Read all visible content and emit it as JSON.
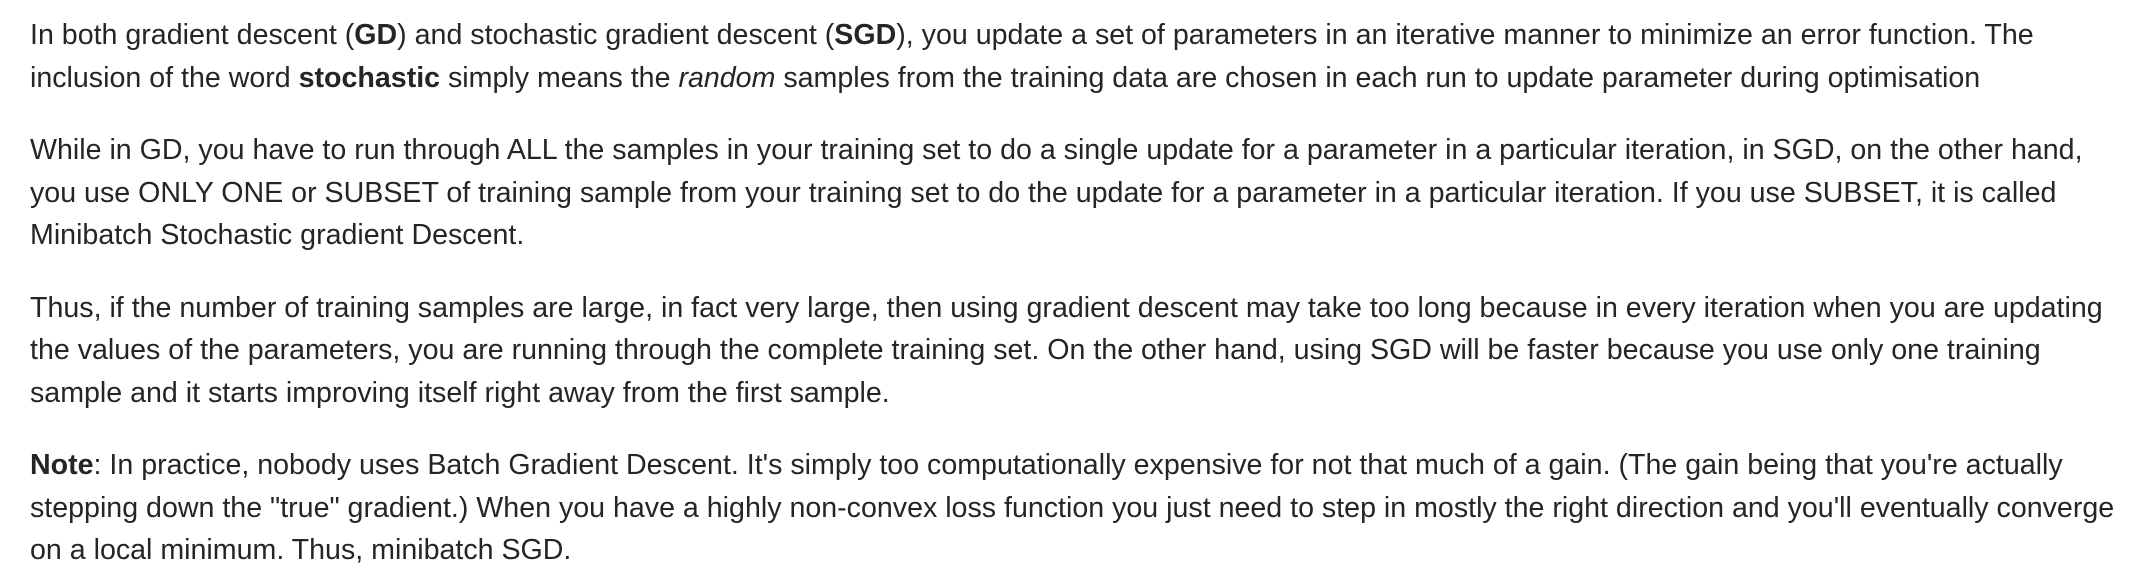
{
  "answer": {
    "p1": {
      "s1": "In both gradient descent (",
      "gd": "GD",
      "s2": ") and stochastic gradient descent (",
      "sgd": "SGD",
      "s3": "), you update a set of parameters in an iterative manner to minimize an error function. The inclusion of the word ",
      "stochastic": "stochastic",
      "s4": " simply means the ",
      "random": "random",
      "s5": " samples from the training data are chosen in each run to update parameter during optimisation"
    },
    "p2": "While in GD, you have to run through ALL the samples in your training set to do a single update for a parameter in a particular iteration, in SGD, on the other hand, you use ONLY ONE or SUBSET of training sample from your training set to do the update for a parameter in a particular iteration. If you use SUBSET, it is called Minibatch Stochastic gradient Descent.",
    "p3": "Thus, if the number of training samples are large, in fact very large, then using gradient descent may take too long because in every iteration when you are updating the values of the parameters, you are running through the complete training set. On the other hand, using SGD will be faster because you use only one training sample and it starts improving itself right away from the first sample.",
    "p4": {
      "note_label": "Note",
      "text": ": In practice, nobody uses Batch Gradient Descent. It's simply too computationally expensive for not that much of a gain. (The gain being that you're actually stepping down the \"true\" gradient.) When you have a highly non-convex loss function you just need to step in mostly the right direction and you'll eventually converge on a local minimum. Thus, minibatch SGD."
    }
  }
}
